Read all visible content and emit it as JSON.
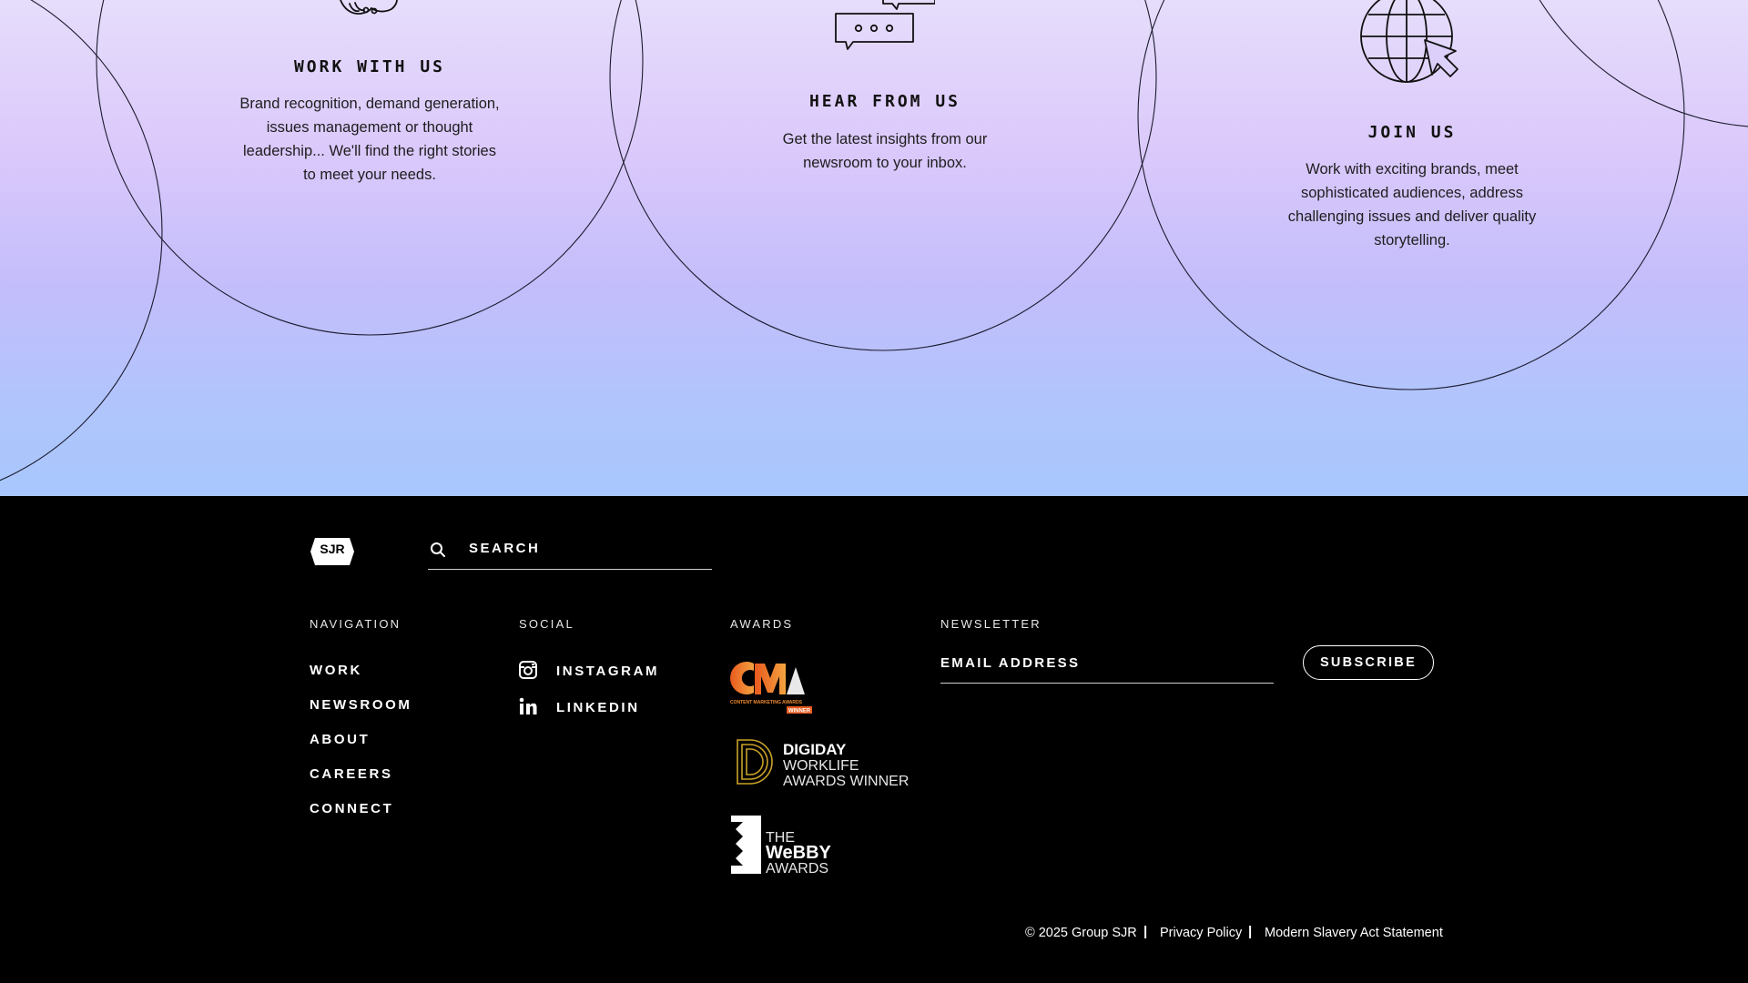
{
  "cards": [
    {
      "title": "WORK WITH US",
      "lines": [
        "Brand recognition, demand generation,",
        "issues management or thought",
        "leadership... We'll find the right stories",
        "to meet your needs."
      ],
      "icon": "handshake-icon"
    },
    {
      "title": "HEAR FROM US",
      "lines": [
        "Get the latest insights from our",
        "newsroom to your inbox."
      ],
      "icon": "chat-bubbles-icon"
    },
    {
      "title": "JOIN US",
      "lines": [
        "Work with exciting brands, meet",
        "sophisticated audiences, address",
        "challenging issues and deliver quality",
        "storytelling."
      ],
      "icon": "globe-cursor-icon"
    }
  ],
  "footer": {
    "logo_text": "SJR",
    "search_label": "SEARCH",
    "navigation": {
      "heading": "NAVIGATION",
      "items": [
        "WORK",
        "NEWSROOM",
        "ABOUT",
        "CAREERS",
        "CONNECT"
      ]
    },
    "social": {
      "heading": "SOCIAL",
      "items": [
        {
          "label": "INSTAGRAM",
          "icon": "instagram-icon"
        },
        {
          "label": "LINKEDIN",
          "icon": "linkedin-icon"
        }
      ]
    },
    "awards": {
      "heading": "AWARDS",
      "items": [
        {
          "logo_text": "CMA",
          "sub_text": "CONTENT MARKETING AWARDS",
          "badge": "WINNER"
        },
        {
          "line1": "DIGIDAY",
          "line2": "WORKLIFE",
          "line3": "AWARDS WINNER"
        },
        {
          "line1": "THE",
          "line2": "WeBBY",
          "line3": "AWARDS"
        }
      ]
    },
    "newsletter": {
      "heading": "NEWSLETTER",
      "email_placeholder": "EMAIL ADDRESS",
      "subscribe_label": "SUBSCRIBE"
    },
    "legal": {
      "copyright": "© 2025 Group SJR",
      "separator": "|",
      "privacy": "Privacy Policy",
      "slavery": "Modern Slavery Act Statement"
    }
  },
  "colors": {
    "footer_bg": "#000000",
    "gradient_top": "#e6ddfb",
    "gradient_bottom": "#a9c7fd",
    "cma_orange": "#f07a22",
    "digiday_gold": "#c9a227"
  }
}
